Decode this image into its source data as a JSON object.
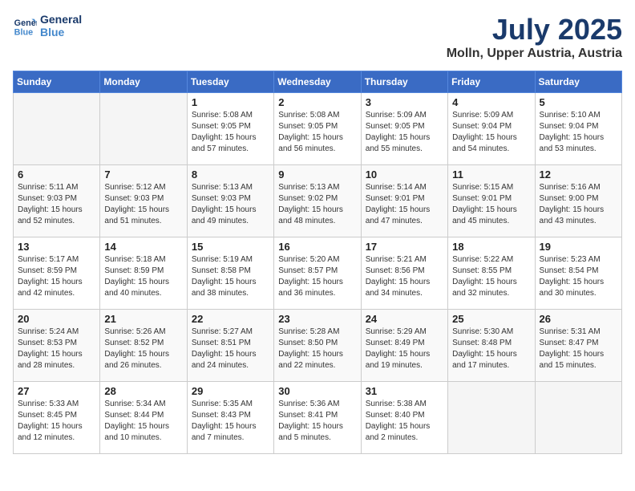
{
  "logo": {
    "line1": "General",
    "line2": "Blue"
  },
  "title": "July 2025",
  "location": "Molln, Upper Austria, Austria",
  "days_of_week": [
    "Sunday",
    "Monday",
    "Tuesday",
    "Wednesday",
    "Thursday",
    "Friday",
    "Saturday"
  ],
  "weeks": [
    [
      {
        "day": "",
        "info": ""
      },
      {
        "day": "",
        "info": ""
      },
      {
        "day": "1",
        "info": "Sunrise: 5:08 AM\nSunset: 9:05 PM\nDaylight: 15 hours\nand 57 minutes."
      },
      {
        "day": "2",
        "info": "Sunrise: 5:08 AM\nSunset: 9:05 PM\nDaylight: 15 hours\nand 56 minutes."
      },
      {
        "day": "3",
        "info": "Sunrise: 5:09 AM\nSunset: 9:05 PM\nDaylight: 15 hours\nand 55 minutes."
      },
      {
        "day": "4",
        "info": "Sunrise: 5:09 AM\nSunset: 9:04 PM\nDaylight: 15 hours\nand 54 minutes."
      },
      {
        "day": "5",
        "info": "Sunrise: 5:10 AM\nSunset: 9:04 PM\nDaylight: 15 hours\nand 53 minutes."
      }
    ],
    [
      {
        "day": "6",
        "info": "Sunrise: 5:11 AM\nSunset: 9:03 PM\nDaylight: 15 hours\nand 52 minutes."
      },
      {
        "day": "7",
        "info": "Sunrise: 5:12 AM\nSunset: 9:03 PM\nDaylight: 15 hours\nand 51 minutes."
      },
      {
        "day": "8",
        "info": "Sunrise: 5:13 AM\nSunset: 9:03 PM\nDaylight: 15 hours\nand 49 minutes."
      },
      {
        "day": "9",
        "info": "Sunrise: 5:13 AM\nSunset: 9:02 PM\nDaylight: 15 hours\nand 48 minutes."
      },
      {
        "day": "10",
        "info": "Sunrise: 5:14 AM\nSunset: 9:01 PM\nDaylight: 15 hours\nand 47 minutes."
      },
      {
        "day": "11",
        "info": "Sunrise: 5:15 AM\nSunset: 9:01 PM\nDaylight: 15 hours\nand 45 minutes."
      },
      {
        "day": "12",
        "info": "Sunrise: 5:16 AM\nSunset: 9:00 PM\nDaylight: 15 hours\nand 43 minutes."
      }
    ],
    [
      {
        "day": "13",
        "info": "Sunrise: 5:17 AM\nSunset: 8:59 PM\nDaylight: 15 hours\nand 42 minutes."
      },
      {
        "day": "14",
        "info": "Sunrise: 5:18 AM\nSunset: 8:59 PM\nDaylight: 15 hours\nand 40 minutes."
      },
      {
        "day": "15",
        "info": "Sunrise: 5:19 AM\nSunset: 8:58 PM\nDaylight: 15 hours\nand 38 minutes."
      },
      {
        "day": "16",
        "info": "Sunrise: 5:20 AM\nSunset: 8:57 PM\nDaylight: 15 hours\nand 36 minutes."
      },
      {
        "day": "17",
        "info": "Sunrise: 5:21 AM\nSunset: 8:56 PM\nDaylight: 15 hours\nand 34 minutes."
      },
      {
        "day": "18",
        "info": "Sunrise: 5:22 AM\nSunset: 8:55 PM\nDaylight: 15 hours\nand 32 minutes."
      },
      {
        "day": "19",
        "info": "Sunrise: 5:23 AM\nSunset: 8:54 PM\nDaylight: 15 hours\nand 30 minutes."
      }
    ],
    [
      {
        "day": "20",
        "info": "Sunrise: 5:24 AM\nSunset: 8:53 PM\nDaylight: 15 hours\nand 28 minutes."
      },
      {
        "day": "21",
        "info": "Sunrise: 5:26 AM\nSunset: 8:52 PM\nDaylight: 15 hours\nand 26 minutes."
      },
      {
        "day": "22",
        "info": "Sunrise: 5:27 AM\nSunset: 8:51 PM\nDaylight: 15 hours\nand 24 minutes."
      },
      {
        "day": "23",
        "info": "Sunrise: 5:28 AM\nSunset: 8:50 PM\nDaylight: 15 hours\nand 22 minutes."
      },
      {
        "day": "24",
        "info": "Sunrise: 5:29 AM\nSunset: 8:49 PM\nDaylight: 15 hours\nand 19 minutes."
      },
      {
        "day": "25",
        "info": "Sunrise: 5:30 AM\nSunset: 8:48 PM\nDaylight: 15 hours\nand 17 minutes."
      },
      {
        "day": "26",
        "info": "Sunrise: 5:31 AM\nSunset: 8:47 PM\nDaylight: 15 hours\nand 15 minutes."
      }
    ],
    [
      {
        "day": "27",
        "info": "Sunrise: 5:33 AM\nSunset: 8:45 PM\nDaylight: 15 hours\nand 12 minutes."
      },
      {
        "day": "28",
        "info": "Sunrise: 5:34 AM\nSunset: 8:44 PM\nDaylight: 15 hours\nand 10 minutes."
      },
      {
        "day": "29",
        "info": "Sunrise: 5:35 AM\nSunset: 8:43 PM\nDaylight: 15 hours\nand 7 minutes."
      },
      {
        "day": "30",
        "info": "Sunrise: 5:36 AM\nSunset: 8:41 PM\nDaylight: 15 hours\nand 5 minutes."
      },
      {
        "day": "31",
        "info": "Sunrise: 5:38 AM\nSunset: 8:40 PM\nDaylight: 15 hours\nand 2 minutes."
      },
      {
        "day": "",
        "info": ""
      },
      {
        "day": "",
        "info": ""
      }
    ]
  ]
}
